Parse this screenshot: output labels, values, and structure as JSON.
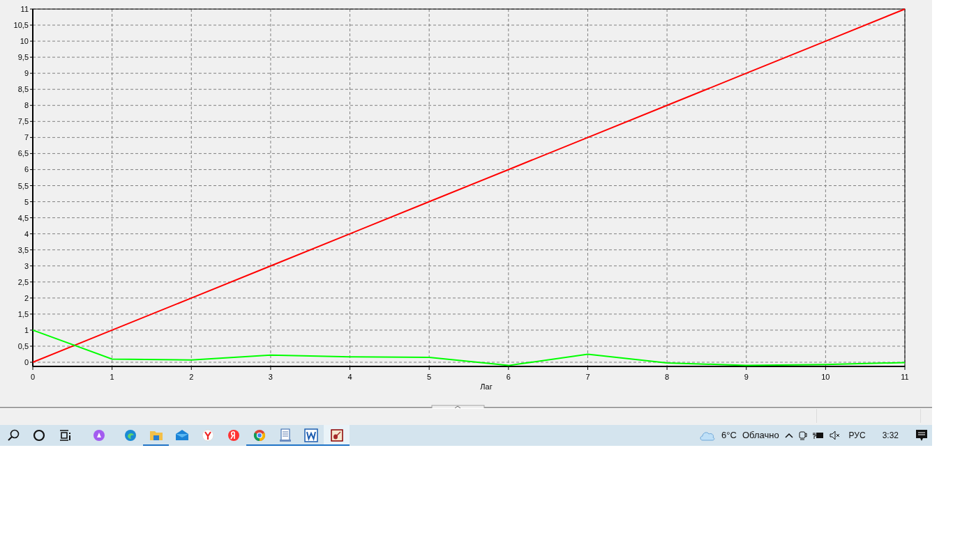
{
  "chart_data": {
    "type": "line",
    "xlabel": "Лаг",
    "x": [
      0,
      1,
      2,
      3,
      4,
      5,
      6,
      7,
      8,
      9,
      10,
      11
    ],
    "series": [
      {
        "color": "#ff0000",
        "values": [
          0,
          1,
          2,
          3,
          4,
          5,
          6,
          7,
          8,
          9,
          10,
          11
        ]
      },
      {
        "color": "#00ff00",
        "values": [
          1,
          0.1,
          0.07,
          0.22,
          0.17,
          0.15,
          -0.1,
          0.25,
          -0.02,
          -0.1,
          -0.07,
          -0.01
        ]
      }
    ],
    "grid": true,
    "xlim": [
      0,
      11
    ],
    "ylim": [
      -0.13,
      11
    ],
    "xticks": [
      0,
      1,
      2,
      3,
      4,
      5,
      6,
      7,
      8,
      9,
      10,
      11
    ],
    "yticks": [
      0,
      {
        "value": 0.5,
        "label": "0,5"
      },
      1,
      {
        "value": 1.5,
        "label": "1,5"
      },
      2,
      {
        "value": 2.5,
        "label": "2,5"
      },
      3,
      {
        "value": 3.5,
        "label": "3,5"
      },
      4,
      {
        "value": 4.5,
        "label": "4,5"
      },
      5,
      {
        "value": 5.5,
        "label": "5,5"
      },
      6,
      {
        "value": 6.5,
        "label": "6,5"
      },
      7,
      {
        "value": 7.5,
        "label": "7,5"
      },
      8,
      {
        "value": 8.5,
        "label": "8,5"
      },
      9,
      {
        "value": 9.5,
        "label": "9,5"
      },
      10,
      {
        "value": 10.5,
        "label": "10,5"
      },
      11
    ]
  },
  "taskbar": {
    "apps": [
      {
        "kind": "search",
        "running": false,
        "selected": false
      },
      {
        "kind": "cortana",
        "running": false,
        "selected": false
      },
      {
        "kind": "taskview",
        "running": false,
        "selected": false
      },
      {
        "kind": "alice",
        "running": false,
        "selected": false
      },
      {
        "kind": "edge",
        "running": false,
        "selected": false
      },
      {
        "kind": "folder",
        "running": true,
        "selected": false
      },
      {
        "kind": "mail",
        "running": false,
        "selected": false
      },
      {
        "kind": "ybrowser",
        "running": false,
        "selected": false
      },
      {
        "kind": "yandex",
        "running": false,
        "selected": false
      },
      {
        "kind": "chrome",
        "running": true,
        "selected": false
      },
      {
        "kind": "document",
        "running": true,
        "selected": false
      },
      {
        "kind": "word",
        "running": true,
        "selected": false
      },
      {
        "kind": "violin",
        "running": true,
        "selected": true
      }
    ],
    "weather": {
      "temperature": "6°C",
      "condition": "Облачно"
    },
    "language": "РУС",
    "time": "3:32"
  }
}
